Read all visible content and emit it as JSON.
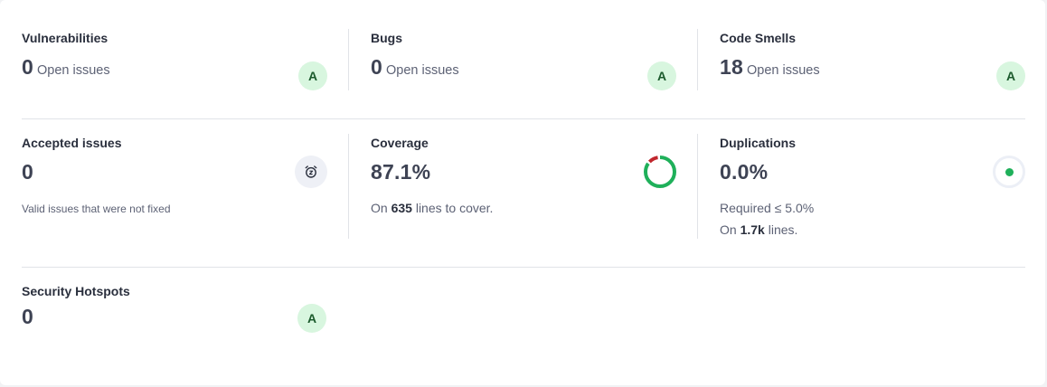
{
  "vulnerabilities": {
    "title": "Vulnerabilities",
    "value": "0",
    "label": "Open issues",
    "grade": "A"
  },
  "bugs": {
    "title": "Bugs",
    "value": "0",
    "label": "Open issues",
    "grade": "A"
  },
  "code_smells": {
    "title": "Code Smells",
    "value": "18",
    "label": "Open issues",
    "grade": "A"
  },
  "accepted_issues": {
    "title": "Accepted issues",
    "value": "0",
    "note": "Valid issues that were not fixed",
    "icon": "alarm-clock-icon"
  },
  "coverage": {
    "title": "Coverage",
    "value": "87.1%",
    "percent": 87.1,
    "prefix": "On",
    "lines": "635",
    "suffix": "lines to cover.",
    "covered_color": "#1fb05a",
    "uncovered_color": "#c0262d"
  },
  "duplications": {
    "title": "Duplications",
    "value": "0.0%",
    "required": "Required ≤ 5.0%",
    "prefix": "On",
    "lines": "1.7k",
    "suffix": "lines.",
    "indicator_color": "#1fb05a"
  },
  "security_hotspots": {
    "title": "Security Hotspots",
    "value": "0",
    "grade": "A"
  },
  "colors": {
    "grade_bg": "#d8f6df",
    "grade_text": "#1b5a2c"
  }
}
